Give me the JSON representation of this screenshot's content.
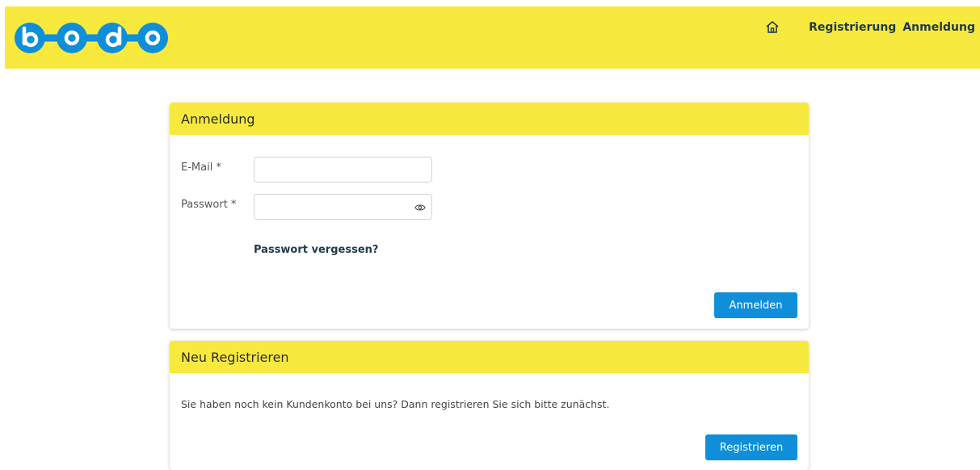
{
  "header": {
    "logo_text": "bodo",
    "nav": [
      {
        "icon": "home-icon"
      },
      {
        "label": "Registrierung"
      },
      {
        "label": "Anmeldung"
      }
    ]
  },
  "login_card": {
    "title": "Anmeldung",
    "email_label": "E-Mail *",
    "email_value": "",
    "password_label": "Passwort *",
    "password_value": "",
    "forgot_link": "Passwort vergessen?",
    "submit_label": "Anmelden"
  },
  "register_card": {
    "title": "Neu Registrieren",
    "text": "Sie haben noch kein Kundenkonto bei uns? Dann registrieren Sie sich bitte zunächst.",
    "submit_label": "Registrieren"
  },
  "colors": {
    "header_bg": "#f8e93f",
    "logo_blue": "#0f8fd9",
    "button_blue": "#0f8fd9",
    "nav_text": "#1e3a4c"
  }
}
